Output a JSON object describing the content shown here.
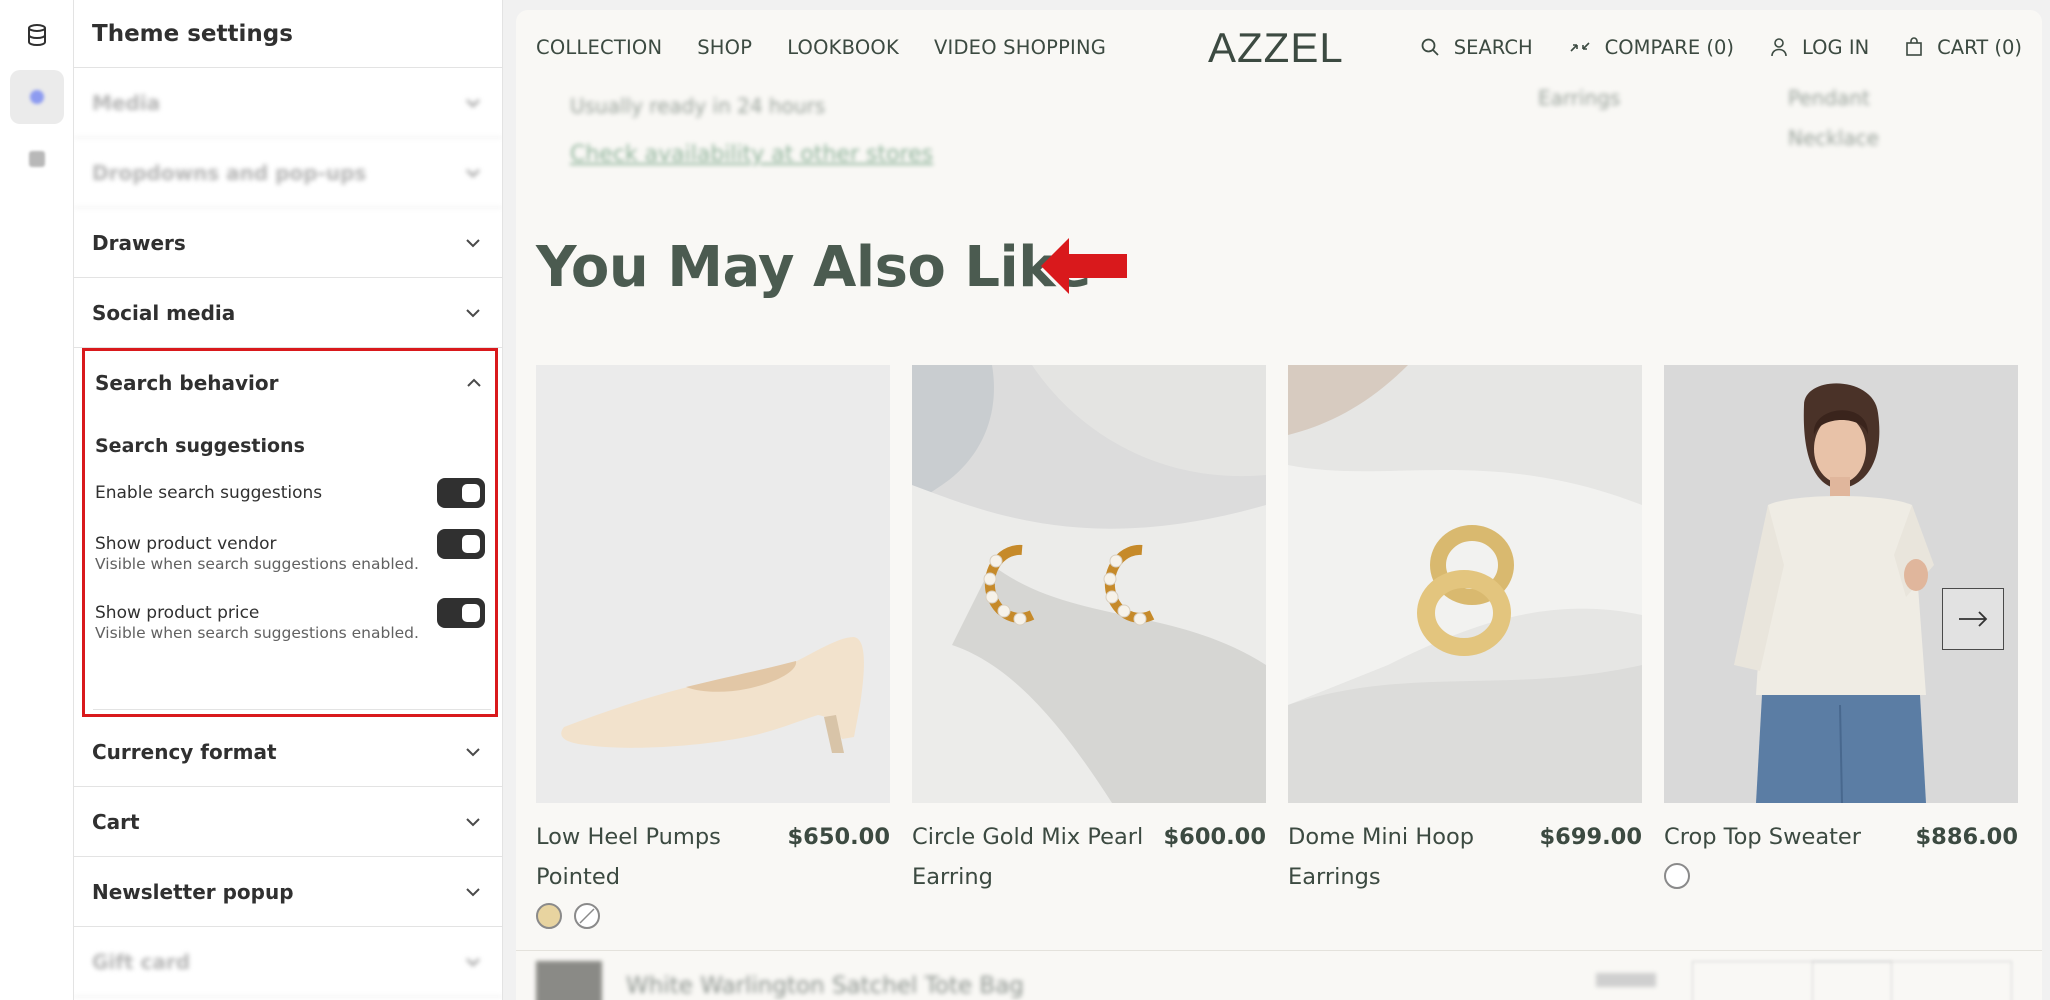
{
  "sidebar": {
    "title": "Theme settings",
    "sections_above": [
      {
        "label": "Media",
        "faded": true
      },
      {
        "label": "Dropdowns and pop-ups",
        "faded": true
      },
      {
        "label": "Drawers",
        "faded": false
      },
      {
        "label": "Social media",
        "faded": false
      }
    ],
    "search_behavior": {
      "label": "Search behavior",
      "subheading": "Search suggestions",
      "options": [
        {
          "label": "Enable search suggestions",
          "enabled": true,
          "help": ""
        },
        {
          "label": "Show product vendor",
          "enabled": true,
          "help": "Visible when search suggestions enabled."
        },
        {
          "label": "Show product price",
          "enabled": true,
          "help": "Visible when search suggestions enabled."
        }
      ]
    },
    "sections_below": [
      {
        "label": "Currency format",
        "faded": false
      },
      {
        "label": "Cart",
        "faded": false
      },
      {
        "label": "Newsletter popup",
        "faded": false
      },
      {
        "label": "Gift card",
        "faded": true
      }
    ]
  },
  "store": {
    "nav_left": [
      "COLLECTION",
      "SHOP",
      "LOOKBOOK",
      "VIDEO SHOPPING"
    ],
    "logo": "AZZEL",
    "nav_right": {
      "search": "SEARCH",
      "compare": "COMPARE (0)",
      "login": "LOG IN",
      "cart": "CART (0)"
    },
    "blurred_text": {
      "ready": "Usually ready in 24 hours",
      "availability": "Check availability at other stores",
      "earrings": "Earrings",
      "pendant": "Pendant",
      "necklace": "Necklace"
    },
    "heading": "You May Also Like",
    "products": [
      {
        "name": "Low Heel Pumps Pointed",
        "price": "$650.00",
        "swatches": [
          "#e8d4a0",
          "none"
        ]
      },
      {
        "name": "Circle Gold Mix Pearl Earring",
        "price": "$600.00",
        "swatches": []
      },
      {
        "name": "Dome Mini Hoop Earrings",
        "price": "$699.00",
        "swatches": []
      },
      {
        "name": "Crop Top Sweater",
        "price": "$886.00",
        "swatches": [
          "#ffffff"
        ]
      }
    ],
    "sticky_bar": {
      "product": "White Warlington Satchel Tote Bag"
    }
  },
  "colors": {
    "accent_red": "#d9191c",
    "brand_text": "#3c4a41",
    "toggle": "#303030"
  }
}
